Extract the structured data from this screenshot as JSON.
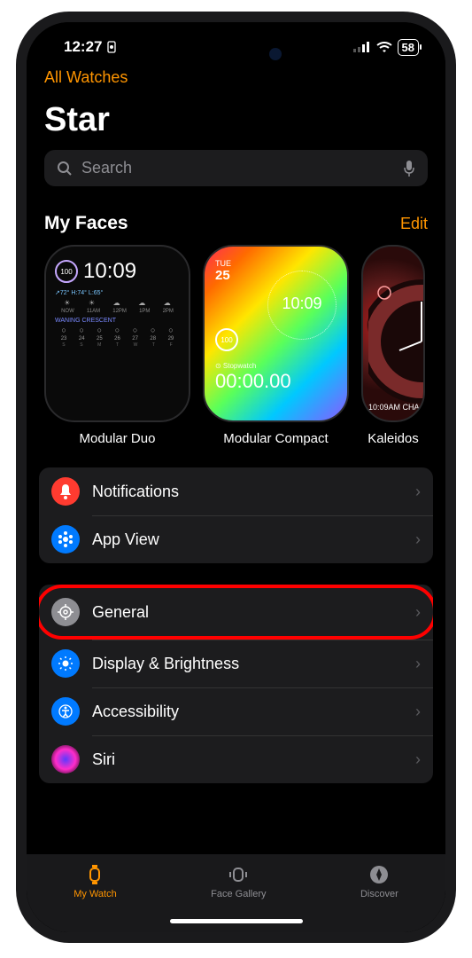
{
  "status": {
    "time": "12:27",
    "battery": "58"
  },
  "nav": {
    "back": "All Watches"
  },
  "title": "Star",
  "search": {
    "placeholder": "Search"
  },
  "faces": {
    "heading": "My Faces",
    "edit": "Edit",
    "items": [
      {
        "label": "Modular Duo",
        "ring": "100",
        "time": "10:09",
        "weather": "↗72° H:74° L:65°",
        "hours": [
          "NOW",
          "11AM",
          "12PM",
          "1PM",
          "2PM"
        ],
        "moon": "WANING CRESCENT",
        "dates": [
          "23",
          "24",
          "25",
          "26",
          "27",
          "28",
          "29"
        ],
        "days": [
          "S",
          "S",
          "M",
          "T",
          "W",
          "T",
          "F"
        ]
      },
      {
        "label": "Modular Compact",
        "day": "TUE",
        "daynum": "25",
        "time": "10:09",
        "ring": "100",
        "stopwatch_label": "⊙ Stopwatch",
        "stopwatch_time": "00:00.00"
      },
      {
        "label": "Kaleidos",
        "time": "10:09AM CHA"
      }
    ]
  },
  "group1": [
    {
      "label": "Notifications",
      "icon": "bell",
      "color": "#ff3b30"
    },
    {
      "label": "App View",
      "icon": "grid",
      "color": "#007aff"
    }
  ],
  "group2": [
    {
      "label": "General",
      "icon": "gear",
      "color": "#8e8e93",
      "highlighted": true
    },
    {
      "label": "Display & Brightness",
      "icon": "sun",
      "color": "#007aff"
    },
    {
      "label": "Accessibility",
      "icon": "person",
      "color": "#007aff"
    },
    {
      "label": "Siri",
      "icon": "siri",
      "color": "#000"
    }
  ],
  "tabs": [
    {
      "label": "My Watch",
      "active": true
    },
    {
      "label": "Face Gallery",
      "active": false
    },
    {
      "label": "Discover",
      "active": false
    }
  ]
}
